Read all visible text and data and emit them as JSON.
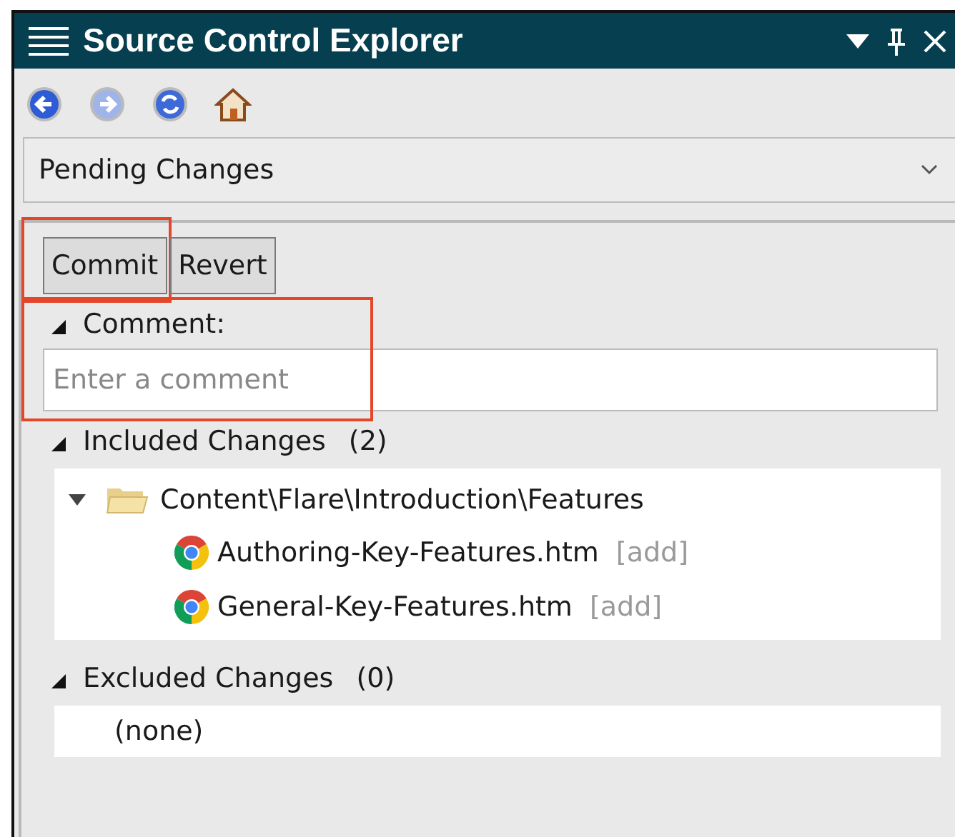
{
  "window": {
    "title": "Source Control Explorer"
  },
  "view_selector": {
    "value": "Pending Changes"
  },
  "buttons": [
    {
      "label": "Commit",
      "highlighted": true
    },
    {
      "label": "Revert",
      "highlighted": false
    }
  ],
  "comment_section": {
    "label": "Comment:",
    "expanded": true,
    "highlighted": true,
    "placeholder": "Enter a comment"
  },
  "included_changes": {
    "label": "Included Changes",
    "count": "(2)",
    "expanded": true,
    "tree": [
      {
        "name": "Content\\Flare\\Introduction\\Features",
        "expanded": true,
        "children": [
          {
            "name": "Authoring-Key-Features.htm",
            "status": "[add]"
          },
          {
            "name": "General-Key-Features.htm",
            "status": "[add]"
          }
        ]
      }
    ]
  },
  "excluded_changes": {
    "label": "Excluded Changes",
    "count": "(0)",
    "expanded": true,
    "items": [
      "(none)"
    ]
  }
}
